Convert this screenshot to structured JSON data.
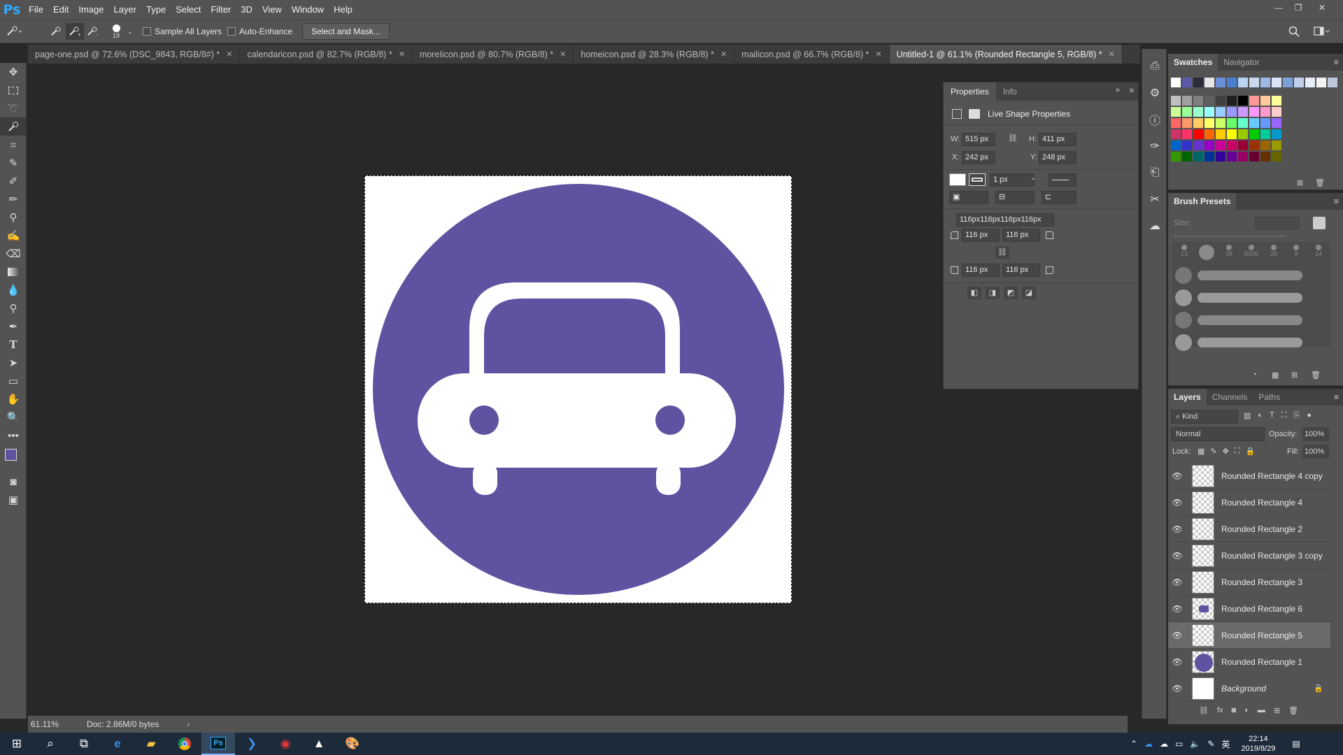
{
  "app": {
    "logo": "Ps"
  },
  "menu": [
    "File",
    "Edit",
    "Image",
    "Layer",
    "Type",
    "Select",
    "Filter",
    "3D",
    "View",
    "Window",
    "Help"
  ],
  "options": {
    "brush_size": "19",
    "sample_all_layers": "Sample All Layers",
    "auto_enhance": "Auto-Enhance",
    "select_mask": "Select and Mask..."
  },
  "tabs": [
    {
      "label": "page-one.psd @ 72.6% (DSC_9843, RGB/8#) *"
    },
    {
      "label": "calendaricon.psd @ 82.7% (RGB/8) *"
    },
    {
      "label": "moreIicon.psd @ 80.7% (RGB/8) *"
    },
    {
      "label": "homeicon.psd @ 28.3% (RGB/8) *"
    },
    {
      "label": "mailicon.psd @ 66.7% (RGB/8) *"
    },
    {
      "label": "Untitled-1 @ 61.1% (Rounded Rectangle 5, RGB/8) *"
    }
  ],
  "status": {
    "zoom": "61.11%",
    "doc": "Doc: 2.86M/0 bytes"
  },
  "properties": {
    "tab1": "Properties",
    "tab2": "Info",
    "title": "Live Shape Properties",
    "w_label": "W:",
    "w": "515 px",
    "h_label": "H:",
    "h": "411 px",
    "x_label": "X:",
    "x": "242 px",
    "y_label": "Y:",
    "y": "248 px",
    "stroke_width": "1 px",
    "radii_all": "116px116px116px116px",
    "r_tl": "116 px",
    "r_tr": "116 px",
    "r_bl": "116 px",
    "r_br": "116 px"
  },
  "swatches": {
    "tab1": "Swatches",
    "tab2": "Navigator",
    "row0": [
      "#ffffff",
      "#5b5aa8",
      "#2b2b3a",
      "#e6e6e6",
      "#6a8fd8",
      "#4a7fd1",
      "#b8d4f0",
      "#c9d8ef",
      "#9cb8e4",
      "#d8e4f4",
      "#7ca0d8",
      "#c0d0ea",
      "#e8eef8",
      "#f4f4f4",
      "#bcc8dc"
    ],
    "grid": [
      [
        "#c0c0c0",
        "#a0a0a0",
        "#808080",
        "#606060",
        "#404040",
        "#202020",
        "#000000",
        "#ff9999",
        "#ffcc99",
        "#ffff99"
      ],
      [
        "#ccff99",
        "#99ff99",
        "#99ffcc",
        "#99ffff",
        "#99ccff",
        "#9999ff",
        "#cc99ff",
        "#ff99ff",
        "#ff99cc",
        "#ffcccc"
      ],
      [
        "#ff6666",
        "#ff9966",
        "#ffcc66",
        "#ffff66",
        "#ccff66",
        "#66ff66",
        "#66ffcc",
        "#66ccff",
        "#6699ff",
        "#9966ff"
      ],
      [
        "#cc3366",
        "#ff3366",
        "#ff0000",
        "#ff6600",
        "#ffcc00",
        "#ffff00",
        "#99cc00",
        "#00cc00",
        "#00cc99",
        "#0099cc"
      ],
      [
        "#0066cc",
        "#3333cc",
        "#6633cc",
        "#9900cc",
        "#cc0099",
        "#cc0066",
        "#990033",
        "#993300",
        "#996600",
        "#999900"
      ],
      [
        "#339900",
        "#006600",
        "#006666",
        "#003399",
        "#330099",
        "#660099",
        "#990066",
        "#660033",
        "#663300",
        "#666600"
      ]
    ]
  },
  "brushes": {
    "title": "Brush Presets",
    "size_label": "Size:",
    "tips": [
      "13",
      "",
      "38",
      "5000",
      "28",
      "9",
      "14"
    ]
  },
  "layers": {
    "tab1": "Layers",
    "tab2": "Channels",
    "tab3": "Paths",
    "kind": "Kind",
    "blend": "Normal",
    "opacity_label": "Opacity:",
    "opacity": "100%",
    "lock_label": "Lock:",
    "fill_label": "Fill:",
    "fill": "100%",
    "items": [
      {
        "name": "Rounded Rectangle 4 copy"
      },
      {
        "name": "Rounded Rectangle 4"
      },
      {
        "name": "Rounded Rectangle 2"
      },
      {
        "name": "Rounded Rectangle 3 copy"
      },
      {
        "name": "Rounded Rectangle 3"
      },
      {
        "name": "Rounded Rectangle 6"
      },
      {
        "name": "Rounded Rectangle 5"
      },
      {
        "name": "Rounded Rectangle 1"
      },
      {
        "name": "Background"
      }
    ]
  },
  "artwork": {
    "circle_color": "#5e52a1",
    "car_color": "#ffffff"
  },
  "taskbar": {
    "time": "22:14",
    "date": "2019/8/29",
    "ime": "英"
  }
}
